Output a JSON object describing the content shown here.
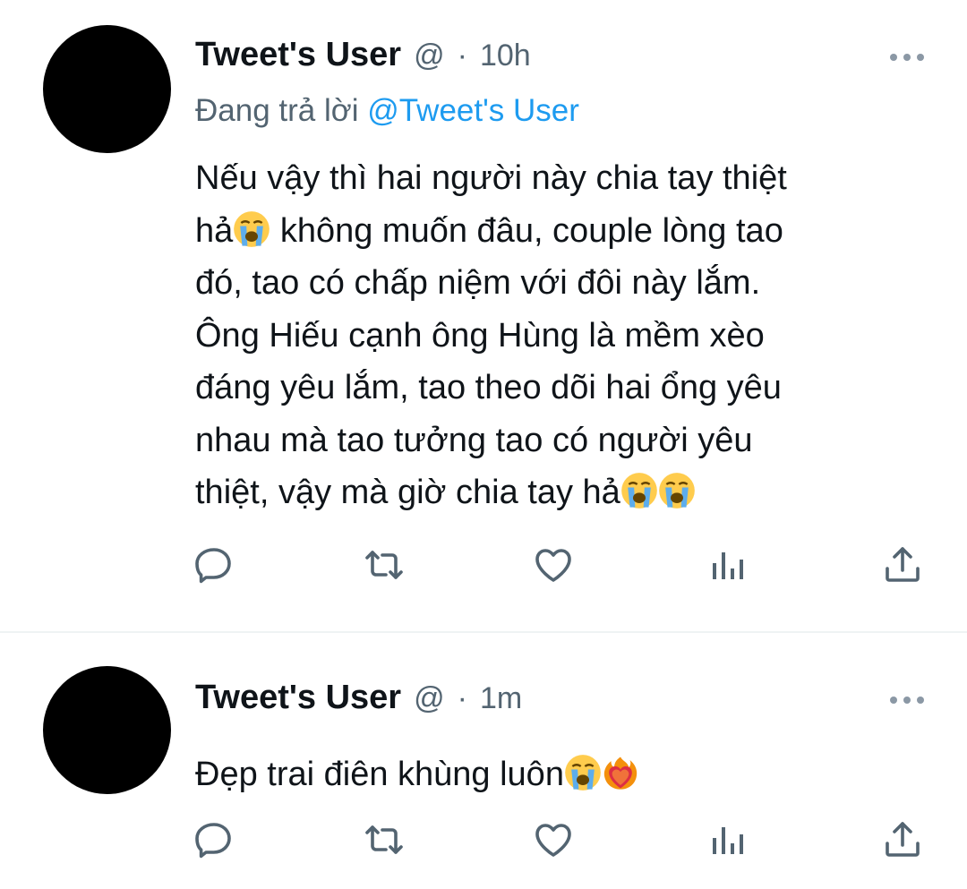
{
  "tweets": [
    {
      "user_name": "Tweet's User",
      "handle": "@",
      "separator": "·",
      "time": "10h",
      "reply_prefix": "Đang trả lời",
      "reply_to": "@Tweet's User",
      "lines": [
        "Nếu vậy thì hai người này chia tay thiệt",
        "hả",
        " không muốn đâu, couple lòng tao",
        "đó, tao có chấp niệm với đôi này lắm.",
        "Ông Hiếu cạnh ông Hùng là mềm xèo",
        "đáng yêu lắm, tao theo dõi hai ổng yêu",
        "nhau mà tao tưởng tao có người yêu",
        "thiệt, vậy mà giờ chia tay hả"
      ],
      "emojis": [
        "loudly-crying-face",
        "loudly-crying-face",
        "loudly-crying-face"
      ]
    },
    {
      "user_name": "Tweet's User",
      "handle": "@",
      "separator": "·",
      "time": "1m",
      "lines": [
        "Đẹp trai điên khùng luôn"
      ],
      "emojis": [
        "loudly-crying-face",
        "heart-on-fire"
      ]
    }
  ],
  "icons": {
    "reply": "speech-bubble-icon",
    "retweet": "retweet-icon",
    "like": "heart-icon",
    "views": "bar-chart-icon",
    "share": "share-upload-icon",
    "more": "more-dots-icon"
  },
  "colors": {
    "text": "#0f1419",
    "secondary": "#536471",
    "link": "#1d9bf0",
    "icon": "#536471",
    "divider": "#eff3f4"
  }
}
